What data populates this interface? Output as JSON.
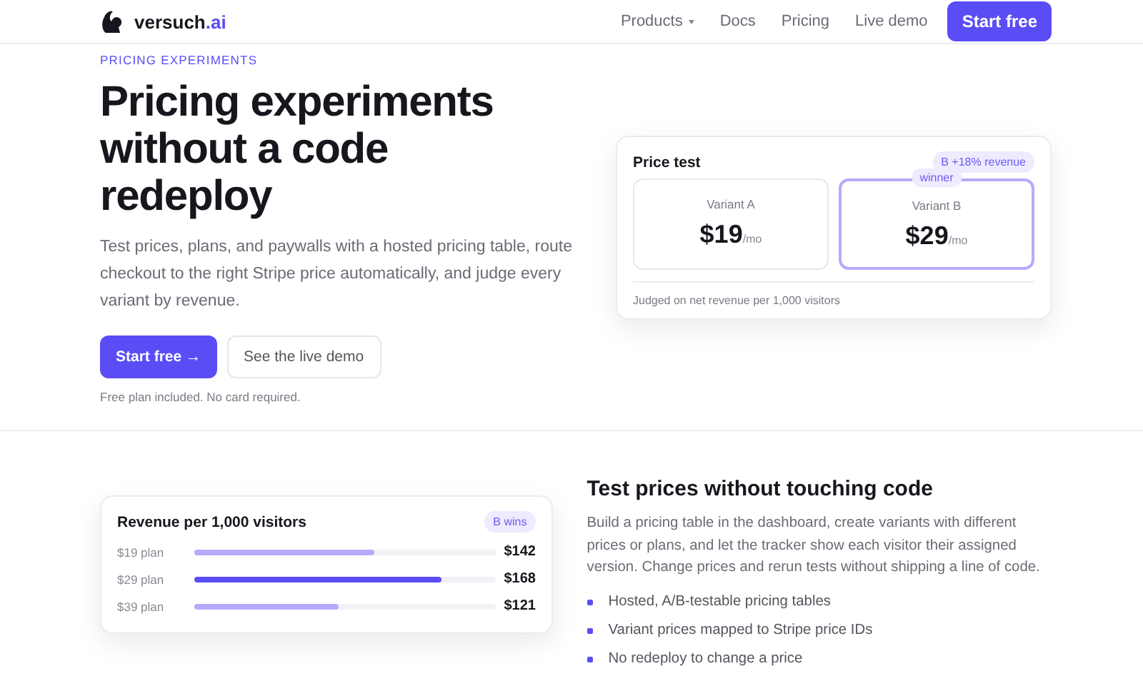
{
  "header": {
    "brand": "versuch",
    "brand_suffix": ".ai",
    "nav": [
      {
        "label": "Products",
        "dropdown": true
      },
      {
        "label": "Docs",
        "dropdown": false
      },
      {
        "label": "Pricing",
        "dropdown": false
      },
      {
        "label": "Live demo",
        "dropdown": false
      }
    ],
    "cta": "Start free"
  },
  "hero": {
    "eyebrow": "PRICING EXPERIMENTS",
    "title": "Pricing experiments without a code redeploy",
    "lead": "Test prices, plans, and paywalls with a hosted pricing table, route checkout to the right Stripe price automatically, and judge every variant by revenue.",
    "buttons": [
      {
        "label": "Start free →",
        "kind": "primary"
      },
      {
        "label": "See the live demo",
        "kind": "secondary"
      }
    ],
    "note": "Free plan included. No card required.",
    "card": {
      "title": "Price test",
      "badge": "B +18% revenue",
      "variants": [
        {
          "name": "Variant A",
          "price": "$19",
          "unit": "/mo",
          "selected": false
        },
        {
          "name": "Variant B",
          "price": "$29",
          "unit": "/mo",
          "selected": true,
          "tag": "winner"
        }
      ],
      "footer": "Judged on net revenue per 1,000 visitors"
    }
  },
  "feature": {
    "card": {
      "title": "Revenue per 1,000 visitors",
      "badge": "B wins",
      "rows": [
        {
          "label": "$19 plan",
          "level": 0.6,
          "value": "$142",
          "highlight": false
        },
        {
          "label": "$29 plan",
          "level": 0.82,
          "value": "$168",
          "highlight": true
        },
        {
          "label": "$39 plan",
          "level": 0.48,
          "value": "$121",
          "highlight": false
        }
      ]
    },
    "title": "Test prices without touching code",
    "text": "Build a pricing table in the dashboard, create variants with different prices or plans, and let the tracker show each visitor their assigned version. Change prices and rerun tests without shipping a line of code.",
    "bullets": [
      "Hosted, A/B-testable pricing tables",
      "Variant prices mapped to Stripe price IDs",
      "No redeploy to change a price"
    ]
  }
}
